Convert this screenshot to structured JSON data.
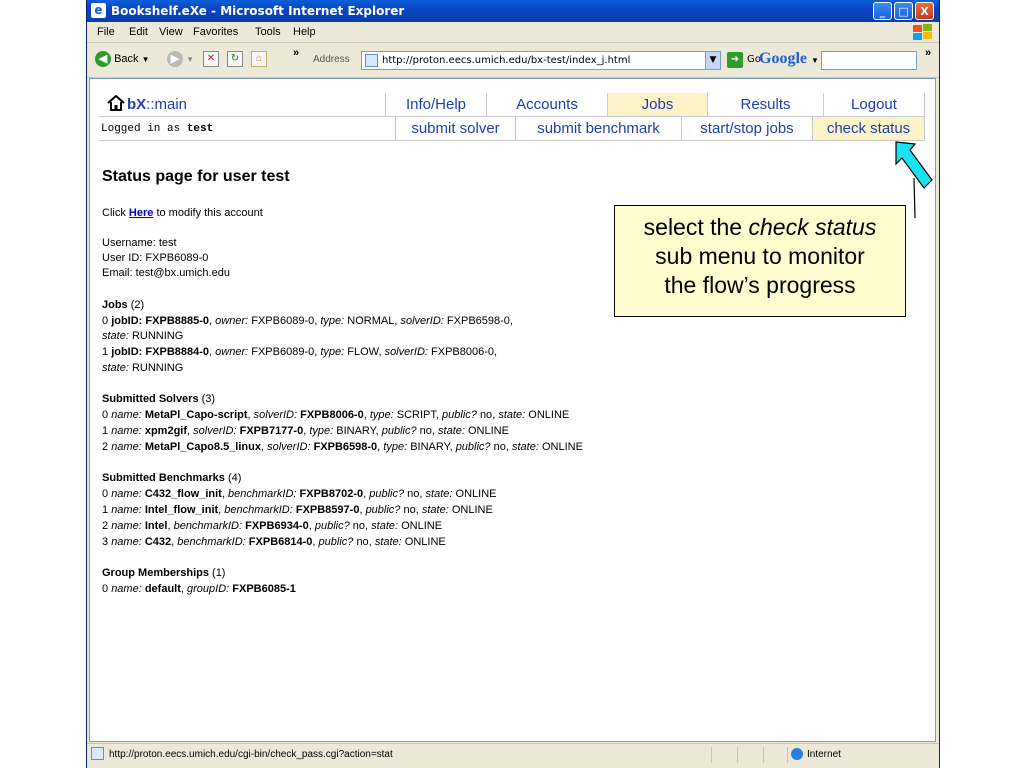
{
  "window": {
    "title": "Bookshelf.eXe - Microsoft Internet Explorer",
    "minimize": "_",
    "maximize": "□",
    "close": "X"
  },
  "menu": [
    "File",
    "Edit",
    "View",
    "Favorites",
    "Tools",
    "Help"
  ],
  "toolbar": {
    "back": "Back",
    "chevron": "»",
    "address_label": "Address",
    "url": "http://proton.eecs.umich.edu/bx-test/index_j.html",
    "go": "Go",
    "google": "Google",
    "google_chevron": "»"
  },
  "nav": {
    "brand_bold": "bX",
    "brand_rest": "::main",
    "top": [
      "Info/Help",
      "Accounts",
      "Jobs",
      "Results",
      "Logout"
    ],
    "logged_prefix": "Logged in as",
    "logged_user": "test",
    "sub": [
      "submit solver",
      "submit benchmark",
      "start/stop jobs",
      "check status"
    ]
  },
  "page": {
    "heading": "Status page for user test",
    "click_prefix": "Click",
    "click_link": "Here",
    "click_suffix": "to modify this account",
    "username": "Username: test",
    "user_id": "User ID: FXPB6089-0",
    "email": "Email: test@bx.umich.edu",
    "jobs": {
      "title": "Jobs",
      "count": "(2)",
      "items": [
        {
          "idx": "0",
          "id": "FXPB8885-0",
          "owner": "FXPB6089-0",
          "type": "NORMAL",
          "solver": "FXPB6598-0",
          "state": "RUNNING"
        },
        {
          "idx": "1",
          "id": "FXPB8884-0",
          "owner": "FXPB6089-0",
          "type": "FLOW",
          "solver": "FXPB8006-0",
          "state": "RUNNING"
        }
      ]
    },
    "solvers": {
      "title": "Submitted Solvers",
      "count": "(3)",
      "items": [
        {
          "idx": "0",
          "name": "MetaPl_Capo-script",
          "id": "FXPB8006-0",
          "type": "SCRIPT",
          "public": "no",
          "state": "ONLINE"
        },
        {
          "idx": "1",
          "name": "xpm2gif",
          "id": "FXPB7177-0",
          "type": "BINARY",
          "public": "no",
          "state": "ONLINE"
        },
        {
          "idx": "2",
          "name": "MetaPl_Capo8.5_linux",
          "id": "FXPB6598-0",
          "type": "BINARY",
          "public": "no",
          "state": "ONLINE"
        }
      ]
    },
    "benchmarks": {
      "title": "Submitted Benchmarks",
      "count": "(4)",
      "items": [
        {
          "idx": "0",
          "name": "C432_flow_init",
          "id": "FXPB8702-0",
          "public": "no",
          "state": "ONLINE"
        },
        {
          "idx": "1",
          "name": "Intel_flow_init",
          "id": "FXPB8597-0",
          "public": "no",
          "state": "ONLINE"
        },
        {
          "idx": "2",
          "name": "Intel",
          "id": "FXPB6934-0",
          "public": "no",
          "state": "ONLINE"
        },
        {
          "idx": "3",
          "name": "C432",
          "id": "FXPB6814-0",
          "public": "no",
          "state": "ONLINE"
        }
      ]
    },
    "groups": {
      "title": "Group Memberships",
      "count": "(1)",
      "items": [
        {
          "idx": "0",
          "name": "default",
          "id": "FXPB6085-1"
        }
      ]
    }
  },
  "statusbar": {
    "url": "http://proton.eecs.umich.edu/cgi-bin/check_pass.cgi?action=stat",
    "zone": "Internet"
  },
  "callout": {
    "line1_prefix": "select the",
    "line1_em": "check status",
    "line2": "sub menu to monitor",
    "line3": "the flow’s progress"
  },
  "labels": {
    "jobID": "jobID:",
    "owner": "owner:",
    "type": "type:",
    "solverID": "solverID:",
    "state": "state:",
    "name": "name:",
    "public": "public?",
    "benchmarkID": "benchmarkID:",
    "groupID": "groupID:"
  },
  "colors": {
    "link": "#1e3faa",
    "active_tab": "#fdf3c8",
    "callout_bg": "#fffdd0",
    "arrow": "#19e3f0"
  }
}
